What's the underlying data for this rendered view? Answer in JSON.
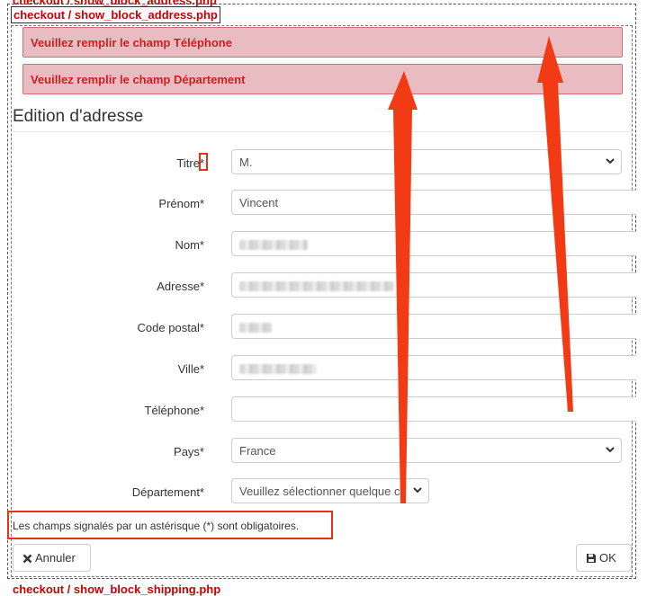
{
  "debug": {
    "top_clipped": "checkout / show_block_address.php",
    "template_label": "checkout / show_block_address.php",
    "bottom_clipped": "checkout / show_block_shipping.php"
  },
  "alerts": [
    "Veuillez remplir le champ Téléphone",
    "Veuillez remplir le champ Département"
  ],
  "form": {
    "title": "Edition d'adresse",
    "fields": {
      "titre": {
        "label": "Titre*",
        "value": "M."
      },
      "prenom": {
        "label": "Prénom*",
        "value": "Vincent"
      },
      "nom": {
        "label": "Nom*",
        "value": ""
      },
      "adresse": {
        "label": "Adresse*",
        "value": ""
      },
      "code_postal": {
        "label": "Code postal*",
        "value": ""
      },
      "ville": {
        "label": "Ville*",
        "value": ""
      },
      "telephone": {
        "label": "Téléphone*",
        "value": ""
      },
      "pays": {
        "label": "Pays*",
        "value": "France"
      },
      "departement": {
        "label": "Département*",
        "value": "Veuillez sélectionner quelque ch"
      }
    },
    "required_note": "Les champs signalés par un astérisque (*) sont obligatoires.",
    "cancel_label": "Annuler",
    "ok_label": "OK"
  },
  "colors": {
    "alert_bg": "#e8bcc0",
    "alert_text": "#cc1f1f",
    "annotation": "#e53216"
  }
}
